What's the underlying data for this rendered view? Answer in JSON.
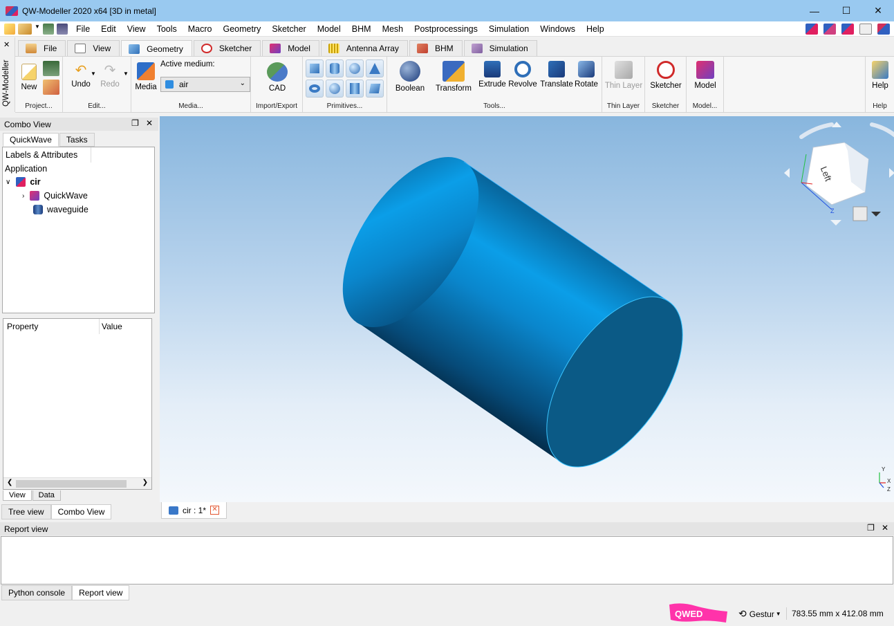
{
  "window": {
    "title": "QW-Modeller 2020 x64 [3D in metal]",
    "minimize": "—",
    "maximize": "☐",
    "close": "✕"
  },
  "menu": [
    "File",
    "Edit",
    "View",
    "Tools",
    "Macro",
    "Geometry",
    "Sketcher",
    "Model",
    "BHM",
    "Mesh",
    "Postprocessings",
    "Simulation",
    "Windows",
    "Help"
  ],
  "sidebar_label": "QW-Modeller",
  "ribbon_tabs": [
    "File",
    "View",
    "Geometry",
    "Sketcher",
    "Model",
    "Antenna Array",
    "BHM",
    "Simulation"
  ],
  "ribbon": {
    "new": "New",
    "undo": "Undo",
    "redo": "Redo",
    "media": "Media",
    "active_medium_label": "Active medium:",
    "active_medium_value": "air",
    "cad": "CAD",
    "boolean": "Boolean",
    "transform": "Transform",
    "extrude": "Extrude",
    "revolve": "Revolve",
    "translate": "Translate",
    "rotate": "Rotate",
    "thin_layer": "Thin Layer",
    "sketcher": "Sketcher",
    "model": "Model",
    "help": "Help",
    "groups": {
      "project": "Project...",
      "edit": "Edit...",
      "media": "Media...",
      "import_export": "Import/Export",
      "primitives": "Primitives...",
      "tools": "Tools...",
      "thin_layer": "Thin Layer",
      "sketcher": "Sketcher",
      "model": "Model...",
      "help": "Help"
    }
  },
  "combo_view": {
    "title": "Combo View",
    "tabs": [
      "QuickWave",
      "Tasks"
    ],
    "tree_header": "Labels & Attributes",
    "tree_root": "Application",
    "tree_items": [
      "cir",
      "QuickWave",
      "waveguide"
    ],
    "prop_headers": [
      "Property",
      "Value"
    ],
    "view_tabs": [
      "View",
      "Data"
    ],
    "bottom_tabs": [
      "Tree view",
      "Combo View"
    ]
  },
  "document_tab": "cir : 1*",
  "nav_cube": {
    "face_label": "Left"
  },
  "axis_labels": {
    "y": "Y",
    "x": "X",
    "z": "Z"
  },
  "report": {
    "title": "Report view",
    "tabs": [
      "Python console",
      "Report view"
    ]
  },
  "status": {
    "logo_text": "QWED",
    "navigation": "Gestur",
    "dimensions": "783.55 mm x 412.08 mm"
  }
}
